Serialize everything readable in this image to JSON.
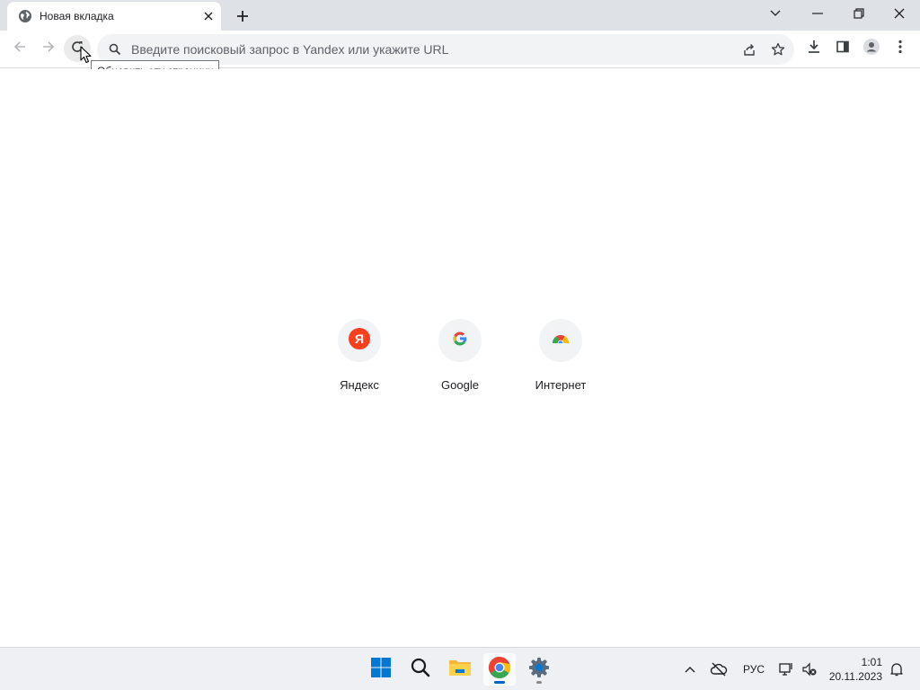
{
  "tab": {
    "title": "Новая вкладка",
    "favicon": "globe-icon"
  },
  "toolbar": {
    "back_icon": "arrow-left-icon",
    "forward_icon": "arrow-right-icon",
    "reload_icon": "reload-icon",
    "reload_tooltip": "Обновить эту страницу"
  },
  "omnibox": {
    "placeholder": "Введите поисковый запрос в Yandex или укажите URL",
    "value": ""
  },
  "shortcuts": [
    {
      "label": "Яндекс",
      "icon": "yandex-icon",
      "color": "#fc3f1d"
    },
    {
      "label": "Google",
      "icon": "google-icon",
      "color": "#4285f4"
    },
    {
      "label": "Интернет",
      "icon": "chrome-web-store-icon",
      "color": "#ea4335"
    }
  ],
  "taskbar": {
    "apps": [
      "windows-start-icon",
      "search-icon",
      "file-explorer-icon",
      "chrome-icon",
      "settings-icon"
    ],
    "tray": {
      "language": "РУС",
      "time": "1:01",
      "date": "20.11.2023"
    }
  }
}
